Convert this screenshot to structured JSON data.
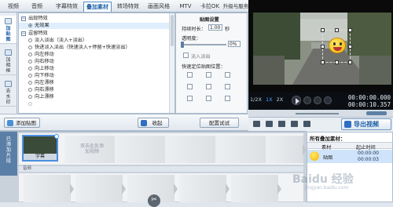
{
  "tabs": [
    "视频",
    "音频",
    "字幕特效",
    "叠加素材",
    "转场特效",
    "画面风格",
    "MTV",
    "卡拉OK",
    "升级与服务"
  ],
  "active_tab": "叠加素材",
  "sidebar": {
    "items": [
      "加贴图",
      "加相框",
      "去水印"
    ],
    "active": "加贴图"
  },
  "effects": {
    "group1": "出现特效",
    "group1_item": "无效果",
    "group2": "逗留特效",
    "items": [
      "淡入淡出（淡入+淡出）",
      "快进淡入淡出（快速淡入+停留+快速淡出）",
      "向左移动",
      "向右移动",
      "向上移动",
      "向下移动",
      "向左漂移",
      "向右漂移",
      "向上漂移"
    ]
  },
  "settings": {
    "title": "贴图设置",
    "duration_label": "持续时长：",
    "duration_value": "1.00",
    "duration_unit": "秒",
    "opacity_label": "透明度：",
    "opacity_value": "0%",
    "fade_label": "淡入淡出",
    "fixed_label": "快速定位贴图位置："
  },
  "buttons": {
    "add_sticker": "添加贴图",
    "collect": "收起",
    "config_test": "配置试试"
  },
  "timeline": {
    "side_label": "已添加片段",
    "clip_name": "字幕",
    "placeholder": "双击此处添加视频",
    "audio_label": "音频"
  },
  "player": {
    "time_current": "00:00:00.000",
    "time_total": "00:00:10.357",
    "speeds": [
      "1/2X",
      "1X",
      "2X"
    ],
    "active_speed": "1X",
    "export_label": "导出视频"
  },
  "added_list": {
    "title": "所有叠加素材：",
    "col_material": "素材",
    "col_time": "起止时间",
    "row_name": "贴图",
    "row_start": "00:00:00",
    "row_end": "00:00:03"
  },
  "watermark": {
    "text": "Baidu 经验",
    "sub": "jingyan.baidu.com"
  },
  "colors": {
    "accent": "#1d5fa6",
    "highlight": "#dfeefd"
  }
}
